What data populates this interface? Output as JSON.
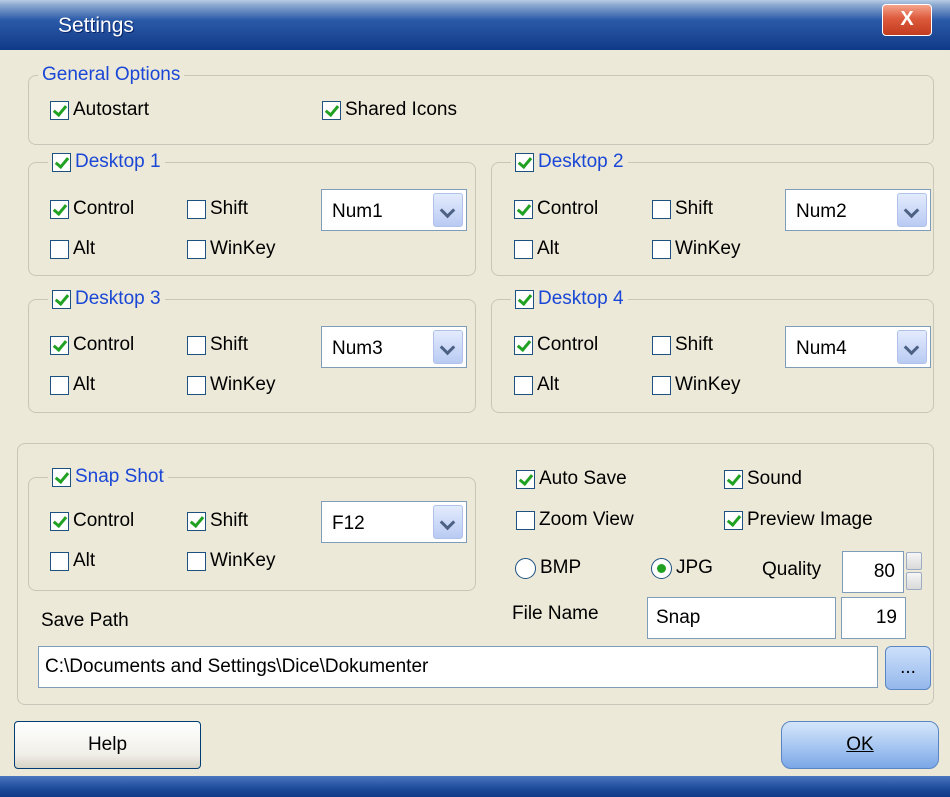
{
  "window": {
    "title": "Settings",
    "close_label": "X"
  },
  "general": {
    "legend": "General Options",
    "autostart": {
      "label": "Autostart",
      "checked": true
    },
    "shared_icons": {
      "label": "Shared Icons",
      "checked": true
    }
  },
  "desktops": [
    {
      "label": "Desktop 1",
      "checked": true,
      "control": "Control",
      "shift": "Shift",
      "alt": "Alt",
      "winkey": "WinKey",
      "key": "Num1"
    },
    {
      "label": "Desktop 2",
      "checked": true,
      "control": "Control",
      "shift": "Shift",
      "alt": "Alt",
      "winkey": "WinKey",
      "key": "Num2"
    },
    {
      "label": "Desktop 3",
      "checked": true,
      "control": "Control",
      "shift": "Shift",
      "alt": "Alt",
      "winkey": "WinKey",
      "key": "Num3"
    },
    {
      "label": "Desktop 4",
      "checked": true,
      "control": "Control",
      "shift": "Shift",
      "alt": "Alt",
      "winkey": "WinKey",
      "key": "Num4"
    }
  ],
  "snapshot": {
    "legend": "Snap Shot",
    "control": "Control",
    "shift": "Shift",
    "alt": "Alt",
    "winkey": "WinKey",
    "key": "F12",
    "auto_save": "Auto Save",
    "sound": "Sound",
    "zoom_view": "Zoom View",
    "preview_image": "Preview Image",
    "bmp": "BMP",
    "jpg": "JPG",
    "quality_label": "Quality",
    "quality": "80",
    "file_name_label": "File Name",
    "file_name": "Snap",
    "counter": "19",
    "save_path_label": "Save Path",
    "save_path": "C:\\Documents and Settings\\Dice\\Dokumenter",
    "browse": "..."
  },
  "buttons": {
    "help": "Help",
    "ok": "OK"
  },
  "colors": {
    "accent": "#1a47d6",
    "title_bar": "#1e4a98",
    "check": "#21a121"
  }
}
